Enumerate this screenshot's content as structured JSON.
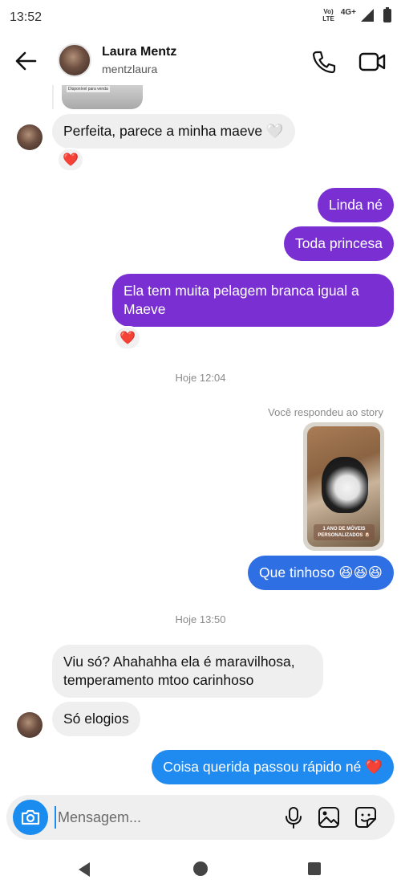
{
  "status_bar": {
    "time": "13:52",
    "volte_top": "Vo)",
    "volte_bottom": "LTE",
    "network": "4G+"
  },
  "header": {
    "contact_name": "Laura Mentz",
    "username": "mentzlaura"
  },
  "thread": {
    "previous_media_caption": "Disponível para venda",
    "messages": [
      {
        "text": "Perfeita, parece a minha maeve 🤍",
        "reaction": "❤️"
      },
      {
        "text": "Linda né"
      },
      {
        "text": "Toda princesa"
      },
      {
        "text": "Ela tem muita pelagem branca igual a Maeve",
        "reaction": "❤️"
      },
      {
        "timestamp": "Hoje 12:04"
      },
      {
        "reply_label": "Você respondeu ao story",
        "story_caption": "1 ANO DE MÓVEIS PERSONALIZADOS 🐶"
      },
      {
        "text": "Que tinhoso 😆😆😆"
      },
      {
        "timestamp": "Hoje 13:50"
      },
      {
        "text": "Viu só? Ahahahha ela é maravilhosa, temperamento mtoo carinhoso"
      },
      {
        "text": "Só elogios"
      },
      {
        "text": "Coisa querida passou rápido né ❤️"
      }
    ]
  },
  "composer": {
    "placeholder": "Mensagem..."
  },
  "colors": {
    "purple": "#7a2fd2",
    "blue": "#2f6fe4",
    "sky": "#1f8af0",
    "incoming": "#efefef"
  },
  "icons": [
    "back-arrow-icon",
    "phone-icon",
    "video-camera-icon",
    "camera-icon",
    "microphone-icon",
    "gallery-icon",
    "sticker-icon",
    "nav-back-icon",
    "nav-home-icon",
    "nav-recents-icon"
  ]
}
